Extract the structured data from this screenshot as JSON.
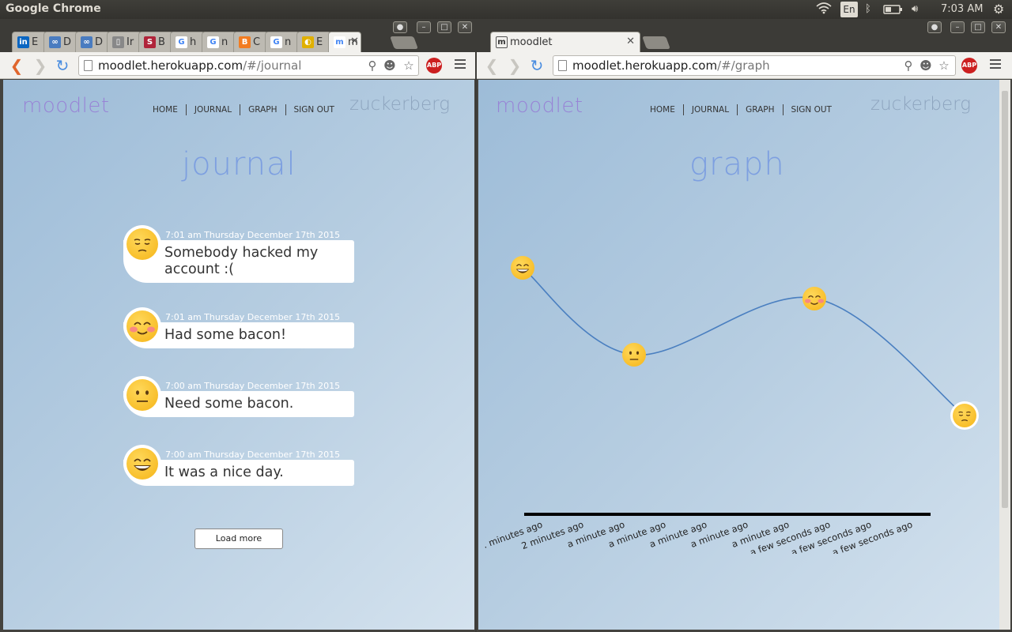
{
  "os": {
    "app_title": "Google Chrome",
    "lang": "En",
    "clock": "7:03 AM"
  },
  "left": {
    "tabs": [
      {
        "fav": "in",
        "label": "E",
        "color": "#0a66c2"
      },
      {
        "fav": "∞",
        "label": "D",
        "color": "#4a7cc0"
      },
      {
        "fav": "∞",
        "label": "D",
        "color": "#4a7cc0"
      },
      {
        "fav": "▯",
        "label": "Ir",
        "color": "#888888"
      },
      {
        "fav": "S",
        "label": "B",
        "color": "#b0243a"
      },
      {
        "fav": "G",
        "label": "h",
        "color": "#ffffff"
      },
      {
        "fav": "G",
        "label": "n",
        "color": "#ffffff"
      },
      {
        "fav": "B",
        "label": "C",
        "color": "#f27c21"
      },
      {
        "fav": "G",
        "label": "n",
        "color": "#ffffff"
      },
      {
        "fav": "◐",
        "label": "E",
        "color": "#e0b000"
      },
      {
        "fav": "m",
        "label": "m",
        "color": "#ffffff"
      }
    ],
    "url_host": "moodlet.herokuapp.com",
    "url_path": "/#/journal",
    "site": {
      "logo": "moodlet",
      "user": "zuckerberg",
      "nav": [
        "HOME",
        "JOURNAL",
        "GRAPH",
        "SIGN OUT"
      ],
      "heading": "journal",
      "entries": [
        {
          "date": "7:01 am Thursday December 17th 2015",
          "text": "Somebody hacked my account :(",
          "mood": "sad"
        },
        {
          "date": "7:01 am Thursday December 17th 2015",
          "text": "Had some bacon!",
          "mood": "blush"
        },
        {
          "date": "7:00 am Thursday December 17th 2015",
          "text": "Need some bacon.",
          "mood": "neutral"
        },
        {
          "date": "7:00 am Thursday December 17th 2015",
          "text": "It was a nice day.",
          "mood": "grin"
        }
      ],
      "load_more": "Load more"
    }
  },
  "right": {
    "tab_label": "moodlet",
    "tab_fav": "m",
    "url_host": "moodlet.herokuapp.com",
    "url_path": "/#/graph",
    "site": {
      "logo": "moodlet",
      "user": "zuckerberg",
      "nav": [
        "HOME",
        "JOURNAL",
        "GRAPH",
        "SIGN OUT"
      ],
      "heading": "graph"
    }
  },
  "chart_data": {
    "type": "line",
    "x": [
      ". minutes ago",
      "2 minutes ago",
      "a minute ago",
      "a minute ago",
      "a minute ago",
      "a minute ago",
      "a minute ago",
      "a few seconds ago",
      "a few seconds ago",
      "a few seconds ago"
    ],
    "points": [
      {
        "x_index": 0,
        "mood": "grin",
        "value": 4
      },
      {
        "x_index": 2.6,
        "mood": "neutral",
        "value": 2
      },
      {
        "x_index": 6.8,
        "mood": "blush",
        "value": 3.3
      },
      {
        "x_index": 10.3,
        "mood": "sad",
        "value": 0.6
      }
    ],
    "colors": {
      "line": "#4a7fc0",
      "axis": "#000000"
    }
  }
}
